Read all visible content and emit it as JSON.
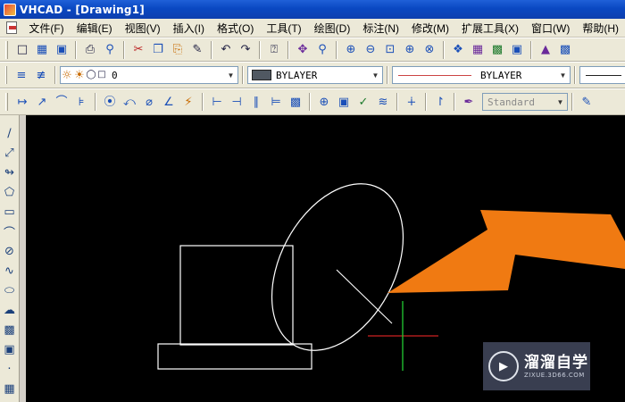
{
  "window": {
    "title": "VHCAD - [Drawing1]"
  },
  "menu": [
    "文件(F)",
    "编辑(E)",
    "视图(V)",
    "插入(I)",
    "格式(O)",
    "工具(T)",
    "绘图(D)",
    "标注(N)",
    "修改(M)",
    "扩展工具(X)",
    "窗口(W)",
    "帮助(H)"
  ],
  "layers": {
    "current_layer": "0",
    "color_value": "BYLAYER",
    "linetype_value": "BYLAYER",
    "text_style": "Standard"
  },
  "toolbar_icons": {
    "standard": [
      "new-file-icon",
      "open-file-icon",
      "save-icon",
      "print-icon",
      "print-preview-icon",
      "cut-icon",
      "copy-icon",
      "paste-icon",
      "match-properties-icon",
      "undo-icon",
      "redo-icon",
      "help-icon",
      "pan-icon",
      "zoom-realtime-icon",
      "zoom-in-icon",
      "zoom-out-icon",
      "zoom-window-icon",
      "zoom-all-icon",
      "zoom-extents-icon",
      "properties-icon",
      "design-center-icon",
      "tool-palette-icon",
      "layer-manager-icon",
      "block-icon",
      "calculator-icon"
    ],
    "dimension": [
      "linear-dimension-icon",
      "aligned-dimension-icon",
      "arc-length-icon",
      "ordinate-icon",
      "radius-icon",
      "jogged-icon",
      "diameter-icon",
      "angular-icon",
      "quick-dimension-icon",
      "baseline-icon",
      "continue-icon",
      "space-icon",
      "break-icon",
      "tolerance-icon",
      "center-mark-icon",
      "inspect-icon",
      "jogged-linear-icon",
      "dimension-edit-icon",
      "text-edit-icon",
      "update-icon",
      "dimension-style-icon"
    ],
    "draw": [
      "line-icon",
      "construction-line-icon",
      "polyline-icon",
      "polygon-icon",
      "rectangle-icon",
      "arc-icon",
      "circle-icon",
      "spline-icon",
      "ellipse-icon",
      "revision-cloud-icon",
      "insert-block-icon",
      "make-block-icon",
      "point-icon",
      "hatch-icon"
    ]
  },
  "watermark": {
    "brand": "溜溜自学",
    "url": "ZIXUE.3D66.COM"
  },
  "colors": {
    "canvas": "#000000",
    "geometry": "#ffffff",
    "crosshair_x": "#cc2222",
    "crosshair_y": "#22cc33",
    "arrow": "#f07a12"
  }
}
